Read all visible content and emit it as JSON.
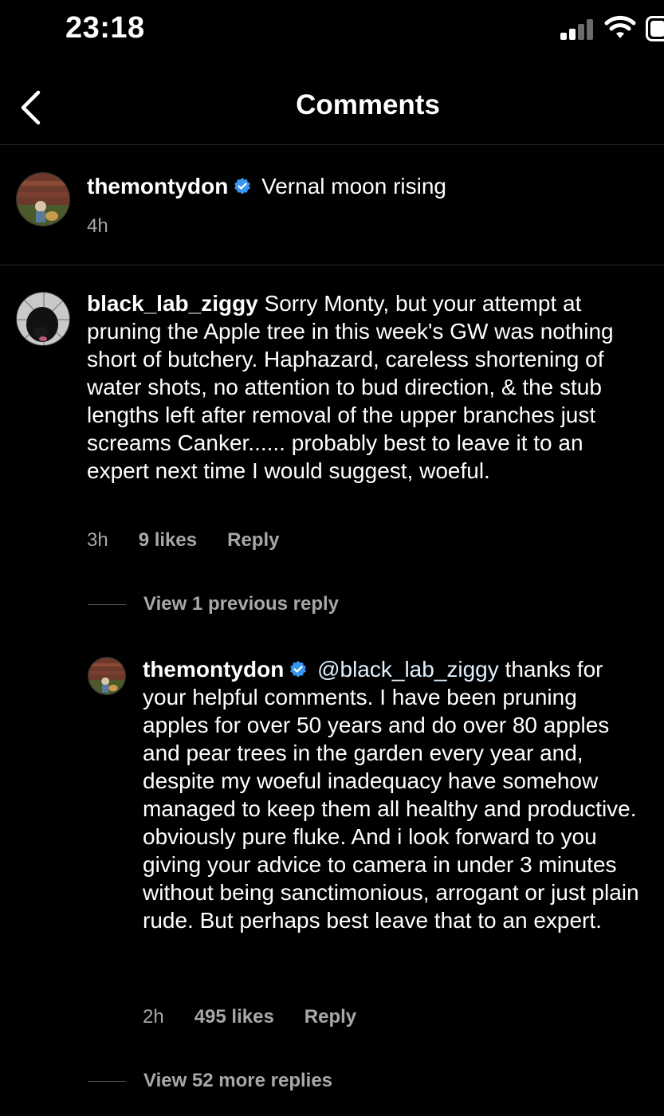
{
  "status_bar": {
    "time": "23:18"
  },
  "header": {
    "title": "Comments"
  },
  "caption": {
    "username": "themontydon",
    "text": "Vernal moon rising",
    "time": "4h"
  },
  "comment": {
    "username": "black_lab_ziggy",
    "text": "Sorry Monty, but your attempt at pruning the Apple tree in this week's GW was nothing short of butchery. Haphazard, careless shortening of water shots, no attention to bud direction, & the stub lengths left after removal of the upper branches just screams Canker...... probably best to leave it to an expert next time I would suggest, woeful.",
    "time": "3h",
    "likes": "9 likes",
    "reply_label": "Reply",
    "view_previous": "View 1 previous reply"
  },
  "reply": {
    "username": "themontydon",
    "mention": "@black_lab_ziggy",
    "text": "thanks for your helpful comments. I have been pruning apples for over 50 years and do over 80 apples and pear trees in the garden every year and, despite my woeful inadequacy have somehow managed to keep them all healthy and productive. obviously pure fluke. And i look forward to you giving your advice to camera in under 3 minutes without being sanctimonious, arrogant or just plain rude. But perhaps best leave that to an expert.",
    "time": "2h",
    "likes": "495 likes",
    "reply_label": "Reply",
    "view_more": "View 52 more replies"
  },
  "colors": {
    "background": "#000000",
    "text": "#ffffff",
    "muted": "#a8a8a8",
    "mention": "#e0f1ff",
    "verified": "#3897f0",
    "divider": "#262626"
  },
  "icons": {
    "back": "chevron-left-icon",
    "verified": "verified-badge-icon",
    "signal": "cellular-signal-icon",
    "wifi": "wifi-icon",
    "battery": "battery-icon"
  }
}
